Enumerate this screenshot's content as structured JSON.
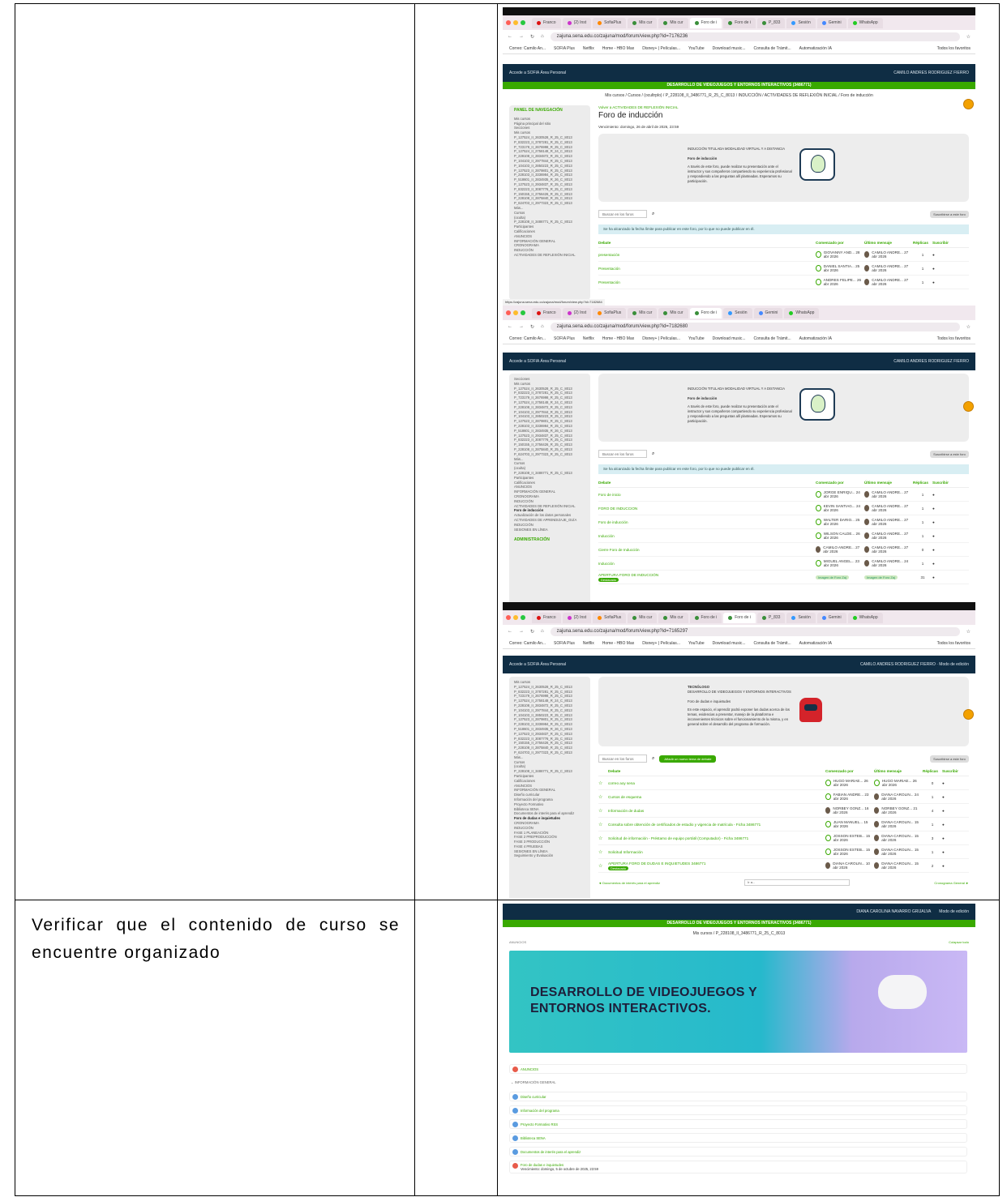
{
  "requirement_text": "Verificar que el contenido de curso se encuentre organizado",
  "browser": {
    "tab_titles": [
      "Franco",
      "(2) Inst",
      "SofiaPlus",
      "Mis cur",
      "Mis cur",
      "Foro de i",
      "Foro de i",
      "P_833",
      "Sesión",
      "Gemini",
      "WhatsApp"
    ],
    "url_1": "zajuna.sena.edu.co/zajuna/mod/forum/view.php?id=7176236",
    "url_2": "zajuna.sena.edu.co/zajuna/mod/forum/view.php?id=7182680",
    "url_3": "zajuna.sena.edu.co/zajuna/mod/forum/view.php?id=7165297",
    "bookmarks": [
      "Correo: Camilo An...",
      "SOFIA Plus",
      "Netflix",
      "Home - HBO Max",
      "Disney+ | Películas...",
      "YouTube",
      "Download music...",
      "Consulta de Trámit...",
      "Automatización IA",
      "Todos los favoritos"
    ],
    "status_url": "https://zajuna.sena.edu.co/zajuna/mod/forum/view.php?id=7182684"
  },
  "site": {
    "nav_left": "Accede a SOFIA   Área Personal",
    "user": "CAMILO ANDRES RODRIGUEZ FIERRO",
    "edit_mode": "Modo de edición",
    "course_bar": "DESARROLLO DE VIDEOJUEGOS Y ENTORNOS INTERACTIVOS (3486771)",
    "breadcrumb": "Mis cursos / Cursos / (ocultrplo) / P_228108_II_3486771_R_25_C_8013 / INDUCCIÓN / ACTIVIDADES DE REFLEXIÓN INICIAL / Foro de inducción"
  },
  "sidebar": {
    "heading": "PANEL DE NAVEGACIÓN",
    "admin_heading": "ADMINISTRACIÓN",
    "items": [
      "Mis cursos",
      "Página principal del sitio",
      "Secciones",
      "Mis cursos",
      "P_127524_II_2630528_R_25_C_8013",
      "P_832223_II_3787281_R_25_C_8013",
      "P_723179_II_2676998_R_25_C_8013",
      "P_127524_II_2758148_R_24_C_8013",
      "P_228108_II_2834872_R_25_C_8013",
      "P_104103_II_2977844_R_25_C_8013",
      "P_104103_II_2850223_R_25_C_8013",
      "P_127523_II_2879801_R_25_C_8013",
      "P_228103_II_3336984_R_25_C_8013",
      "P_518601_II_2834935_R_26_C_8013",
      "P_127523_II_2934837_R_25_C_8013",
      "P_832223_II_3087776_R_25_C_8013",
      "P_150155_II_2756426_R_25_C_8013",
      "P_228108_II_2875840_R_25_C_8013",
      "P_624703_II_2977323_R_25_C_8013",
      "Más...",
      "Cursos",
      "(oculta)",
      "P_228108_II_3486771_R_25_C_8013",
      "Participantes",
      "Calificaciones",
      "ANUNCIOS",
      "INFORMACIÓN GENERAL",
      "CRONOGRAMA",
      "INDUCCIÓN",
      "ACTIVIDADES DE REFLEXIÓN INICIAL",
      "Foro de inducción",
      "Actualización de los datos personales",
      "ACTIVIDADES DE APRENDIZAJE_GUÍA INDUCCIÓN",
      "SESIONES EN LÍNEA"
    ],
    "info_items": [
      "Diseño curricular",
      "Información del programa",
      "Proyecto Formativo",
      "Biblioteca SENA",
      "Documentos de interés para el aprendiz",
      "Foro de dudas e inquietudes",
      "CRONOGRAMA",
      "INDUCCIÓN",
      "FASE 1 PLANEACIÓN",
      "FASE 2 PREPRODUCCIÓN",
      "FASE 3 PRODUCCIÓN",
      "FASE 4 PRUEBAS",
      "SESIONES EN LÍNEA",
      "Seguimiento y Evaluación"
    ]
  },
  "forum": {
    "back_link": "Volver a ACTIVIDADES DE REFLEXIÓN INICIAL",
    "title": "Foro de inducción",
    "due": "Vencimiento: domingo, 26 de abril de 2026, 23:59",
    "banner_heading": "INDUCCIÓN TITULADA MODALIDAD VIRTUAL Y A DISTANCIA",
    "banner_sub": "Foro de inducción",
    "banner_text": "A través de este foro, puede realizar su presentación ante el instructor y sus compañeros compartiendo su experiencia profesional y respondiendo a las preguntas allí planteadas. Esperamos su participación.",
    "search_placeholder": "Buscar en los foros",
    "subscribe": "Suscribirse a este foro",
    "info_notice": "Se ha alcanzado la fecha límite para publicar en este foro, por lo que no puede publicar en él.",
    "headers": [
      "Debate",
      "Comenzado por",
      "Último mensaje",
      "Réplicas",
      "Suscribir"
    ],
    "rows_a": [
      {
        "t": "presentación",
        "p": "GIOVANNY AND... 28 abr 2026",
        "l": "CAMILO ANDRE... 27 abr 2026",
        "r": "1"
      },
      {
        "t": "Presentación",
        "p": "DANIEL SANTIA... 25 abr 2026",
        "l": "CAMILO ANDRE... 27 abr 2026",
        "r": "1"
      },
      {
        "t": "Presentación",
        "p": "ANDRES FELIPE... 26 abr 2026",
        "l": "CAMILO ANDRE... 27 abr 2026",
        "r": "1"
      }
    ],
    "rows_b": [
      {
        "t": "Foro de inicio",
        "p": "JORGE ENRIQU... 24 abr 2026",
        "l": "CAMILO ANDRE... 27 abr 2026",
        "r": "1"
      },
      {
        "t": "FORO DE INDUCCION",
        "p": "KEVIN SANTIAG... 24 abr 2026",
        "l": "CAMILO ANDRE... 27 abr 2026",
        "r": "1"
      },
      {
        "t": "Foro de inducción",
        "p": "WALTER DARIO... 25 abr 2026",
        "l": "CAMILO ANDRE... 27 abr 2026",
        "r": "1"
      },
      {
        "t": "Inducción",
        "p": "WILSON CALDE... 26 abr 2026",
        "l": "CAMILO ANDRE... 27 abr 2026",
        "r": "1"
      },
      {
        "t": "Cierre Foro de Inducción",
        "p": "CAMILO ANDRE... 27 abr 2026",
        "l": "CAMILO ANDRE... 27 abr 2026",
        "r": "0"
      },
      {
        "t": "Inducción",
        "p": "MIGUEL ANGEL... 23 abr 2026",
        "l": "CAMILO ANDRE... 24 abr 2026",
        "r": "1"
      },
      {
        "t": "APERTURA FORO DE INDUCCIÓN",
        "p": "Imagen de Foro Zaj",
        "l": "Imagen de Foro Zaj",
        "r": "31"
      }
    ],
    "pinned": "Destacado"
  },
  "forum2": {
    "banner_heading": "TECNÓLOGO",
    "banner_program": "DESARROLLO DE VIDEOJUEGOS Y ENTORNOS INTERACTIVOS",
    "banner_sub": "Foro de dudas e inquietudes",
    "banner_text": "En este espacio, el aprendiz podrá exponer las dudas acerca de los temas, evidencias a presentar, manejo de la plataforma e inconvenientes técnicos sobre el funcionamiento de la misma, y en general sobre el desarrollo del programa de formación.",
    "add_button": "Añadir un nuevo tema de debate",
    "rows": [
      {
        "t": "correo aoy sena",
        "p": "HUGO MARIAE... 26 abr 2026",
        "l": "HUGO MARIAE... 26 abr 2026",
        "r": "0"
      },
      {
        "t": "Cursos de esquema",
        "p": "FABIAN ANDRE... 23 abr 2026",
        "l": "DIANA CAROLIN... 24 abr 2026",
        "r": "1"
      },
      {
        "t": "Información de dudas",
        "p": "NORBEY GONZ... 16 abr 2026",
        "l": "NORBEY GONZ... 21 abr 2026",
        "r": "4"
      },
      {
        "t": "Consulta sobre obtención de certificados de estudio y vigencia de matrícula - Ficha 3486771",
        "p": "JUAN MANUEL... 15 abr 2026",
        "l": "DIANA CAROLIN... 15 abr 2026",
        "r": "1"
      },
      {
        "t": "Solicitud de información - Préstamo de equipo portátil (Computador) - Ficha 3486771",
        "p": "JOSSON ESTEB... 15 abr 2026",
        "l": "DIANA CAROLIN... 15 abr 2026",
        "r": "3"
      },
      {
        "t": "Solicitud Información",
        "p": "JOSSON ESTEB... 15 abr 2026",
        "l": "DIANA CAROLIN... 15 abr 2026",
        "r": "1"
      },
      {
        "t": "APERTURA FORO DE DUDAS E INQUIETUDES 3486771",
        "p": "DIANA CAROLIN... 10 abr 2026",
        "l": "DIANA CAROLIN... 15 abr 2026",
        "r": "2"
      }
    ],
    "prev": "◄ Documentos de interés para el aprendiz",
    "next": "Cronograma General ►",
    "jump": "Ir a..."
  },
  "course": {
    "user": "DIANA CAROLINA NAVARRO GRIJALVA",
    "course_bar": "DESARROLLO DE VIDEOJUEGOS Y ENTORNOS INTERACTIVOS (3486771)",
    "breadcrumb": "Mis cursos / P_228108_II_3486771_R_25_C_8013",
    "section_label": "ANUNCIOS",
    "collapse_all": "Colapsar todo",
    "hero_title_line1": "DESARROLLO DE VIDEOJUEGOS Y",
    "hero_title_line2": "ENTORNOS INTERACTIVOS.",
    "announcement": "ANUNCIOS",
    "section2": "INFORMACIÓN GENERAL",
    "items": [
      "Diseño curricular",
      "Información del programa",
      "Proyecto Formativo  RSS",
      "Biblioteca SENA",
      "Documentos de interés para el aprendiz",
      "Foro de dudas e inquietudes"
    ],
    "last_item_note": "Vencimiento: domingo, 5 de octubre de 2025, 23:59",
    "colors": {
      "green": "#39A900",
      "navy": "#0F2D44",
      "hero_cyan": "#2ABDCB",
      "hero_lilac": "#C9B8F5"
    }
  }
}
